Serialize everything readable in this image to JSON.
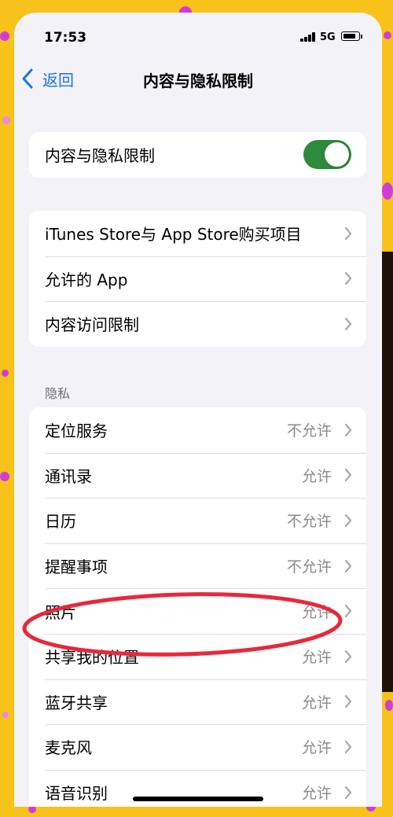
{
  "status_bar": {
    "time": "17:53",
    "network": "5G",
    "signal_icon": "signal-bars-icon",
    "battery_icon": "battery-icon"
  },
  "nav": {
    "back_label": "返回",
    "title": "内容与隐私限制",
    "back_icon": "chevron-left-icon"
  },
  "master_toggle": {
    "label": "内容与隐私限制",
    "state": "on",
    "on_color": "#2e8b3d"
  },
  "restrictions": [
    {
      "label": "iTunes Store与 App Store购买项目"
    },
    {
      "label": "允许的 App"
    },
    {
      "label": "内容访问限制"
    }
  ],
  "privacy": {
    "header": "隐私",
    "items": [
      {
        "label": "定位服务",
        "value": "不允许"
      },
      {
        "label": "通讯录",
        "value": "允许"
      },
      {
        "label": "日历",
        "value": "不允许"
      },
      {
        "label": "提醒事项",
        "value": "不允许"
      },
      {
        "label": "照片",
        "value": "允许"
      },
      {
        "label": "共享我的位置",
        "value": "允许"
      },
      {
        "label": "蓝牙共享",
        "value": "允许"
      },
      {
        "label": "麦克风",
        "value": "允许"
      },
      {
        "label": "语音识别",
        "value": "允许"
      }
    ]
  },
  "colors": {
    "accent": "#1a73e8",
    "annotation": "#e8283c",
    "frame": "#f7c21a"
  }
}
